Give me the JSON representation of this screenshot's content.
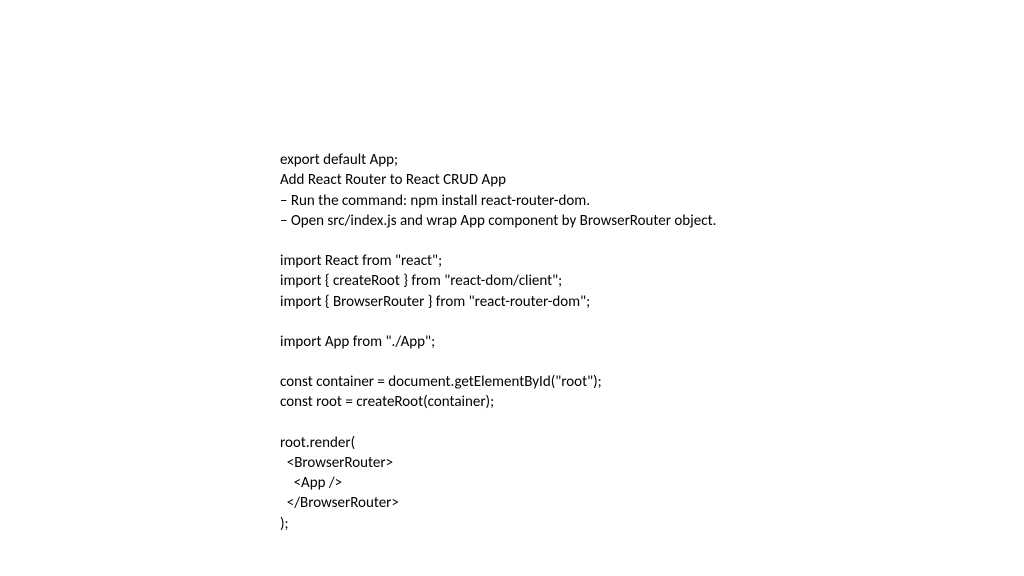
{
  "lines": [
    "export default App;",
    "Add React Router to React CRUD App",
    "– Run the command: npm install react-router-dom.",
    "– Open src/index.js and wrap App component by BrowserRouter object.",
    "",
    "import React from \"react\";",
    "import { createRoot } from \"react-dom/client\";",
    "import { BrowserRouter } from \"react-router-dom\";",
    "",
    "import App from \"./App\";",
    "",
    "const container = document.getElementById(\"root\");",
    "const root = createRoot(container);",
    "",
    "root.render(",
    "  <BrowserRouter>",
    "    <App />",
    "  </BrowserRouter>",
    ");"
  ]
}
